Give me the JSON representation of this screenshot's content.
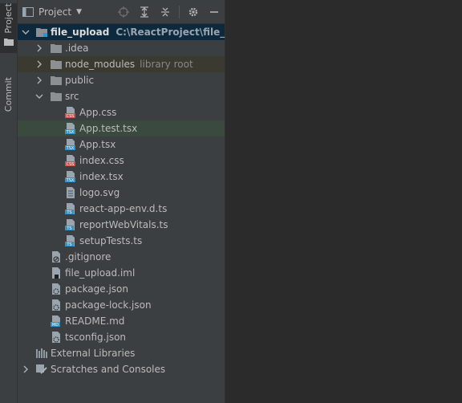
{
  "side_tabs": {
    "project": "Project",
    "commit": "Commit"
  },
  "toolbar": {
    "title": "Project"
  },
  "tree": {
    "root_name": "file_upload",
    "root_path": "C:\\ReactProject\\file_upload",
    "idea": ".idea",
    "node_modules": "node_modules",
    "node_modules_hint": "library root",
    "public": "public",
    "src": "src",
    "src_files": [
      "App.css",
      "App.test.tsx",
      "App.tsx",
      "index.css",
      "index.tsx",
      "logo.svg",
      "react-app-env.d.ts",
      "reportWebVitals.ts",
      "setupTests.ts"
    ],
    "root_files": [
      ".gitignore",
      "file_upload.iml",
      "package.json",
      "package-lock.json",
      "README.md",
      "tsconfig.json"
    ],
    "external_libraries": "External Libraries",
    "scratches": "Scratches and Consoles"
  },
  "colors": {
    "panel_bg": "#3c3f41",
    "editor_bg": "#2b2b2b",
    "root_highlight": "#0d293e",
    "selected_row": "#3a4a3f",
    "excluded_row": "#3b3a30",
    "folder": "#8c9092",
    "css_badge": "#c75450",
    "tsx_badge": "#3592c4",
    "ts_badge": "#3592c4"
  },
  "icons": {
    "project_tab": "folder-icon",
    "commit_tab": "commit-icon",
    "locate": "crosshair-icon",
    "expand_all": "expand-all-icon",
    "collapse_all": "collapse-all-icon",
    "settings": "gear-icon",
    "hide": "minus-icon"
  }
}
